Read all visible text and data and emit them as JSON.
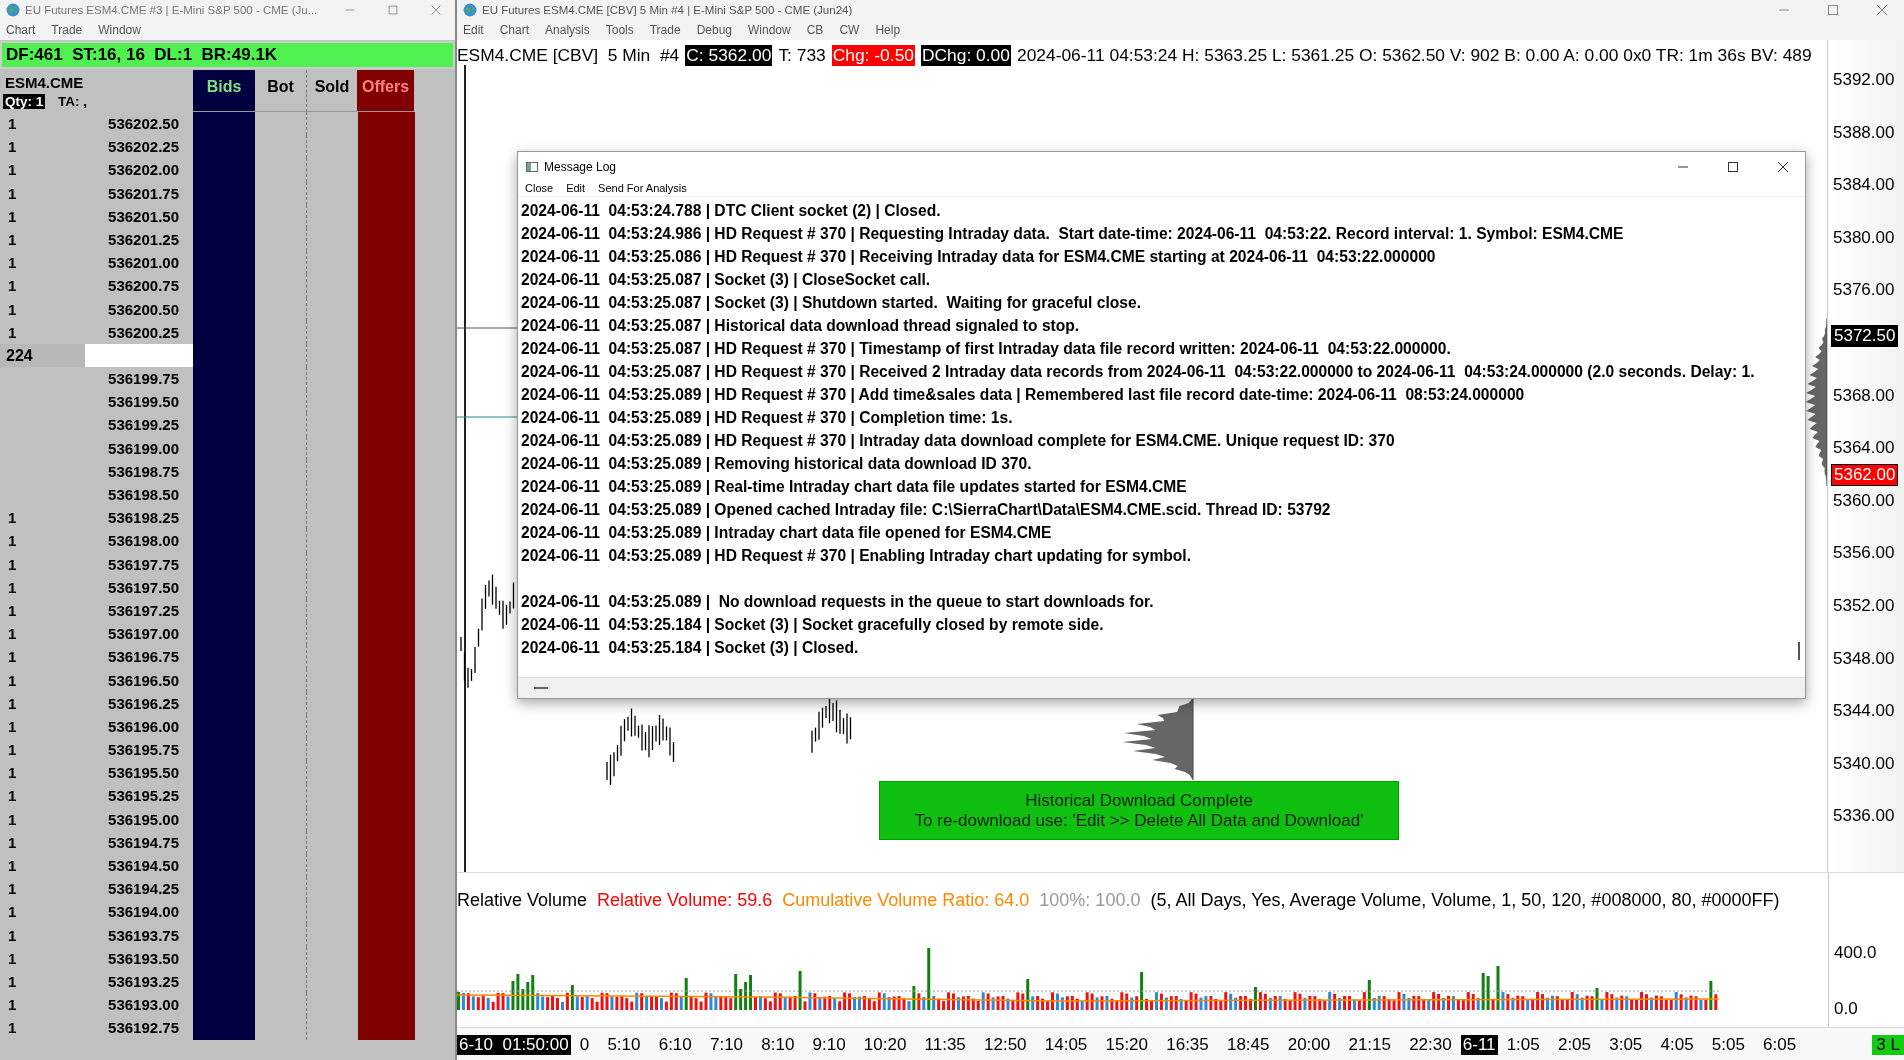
{
  "left_window": {
    "title": "EU Futures ESM4.CME #3 | E-Mini S&P 500 - CME (Ju...",
    "menu": [
      "Chart",
      "Trade",
      "Window"
    ],
    "status_text": "DF:461  ST:16, 16  DL:1  BR:49.1K",
    "symbol": "ESM4.CME",
    "qty_badge": "Qty: 1",
    "ta_label": "TA: ,",
    "columns": [
      {
        "label": "Bids",
        "kind": "bids"
      },
      {
        "label": "Bot",
        "kind": "plain"
      },
      {
        "label": "Sold",
        "kind": "plain"
      },
      {
        "label": "Offers",
        "kind": "offers"
      }
    ],
    "rows": [
      {
        "qty": "1",
        "price": "536202.50",
        "kind": "price"
      },
      {
        "qty": "1",
        "price": "536202.25",
        "kind": "price"
      },
      {
        "qty": "1",
        "price": "536202.00",
        "kind": "price"
      },
      {
        "qty": "1",
        "price": "536201.75",
        "kind": "price"
      },
      {
        "qty": "1",
        "price": "536201.50",
        "kind": "price"
      },
      {
        "qty": "1",
        "price": "536201.25",
        "kind": "price"
      },
      {
        "qty": "1",
        "price": "536201.00",
        "kind": "price"
      },
      {
        "qty": "1",
        "price": "536200.75",
        "kind": "price"
      },
      {
        "qty": "1",
        "price": "536200.50",
        "kind": "price"
      },
      {
        "qty": "1",
        "price": "536200.25",
        "kind": "price"
      },
      {
        "qty": "224",
        "kind": "current"
      },
      {
        "price": "536199.75",
        "kind": "price"
      },
      {
        "price": "536199.50",
        "kind": "price"
      },
      {
        "price": "536199.25",
        "kind": "price"
      },
      {
        "price": "536199.00",
        "kind": "price"
      },
      {
        "price": "536198.75",
        "kind": "price"
      },
      {
        "price": "536198.50",
        "kind": "price"
      },
      {
        "qty": "1",
        "price": "536198.25",
        "kind": "price"
      },
      {
        "qty": "1",
        "price": "536198.00",
        "kind": "price"
      },
      {
        "qty": "1",
        "price": "536197.75",
        "kind": "price"
      },
      {
        "qty": "1",
        "price": "536197.50",
        "kind": "price"
      },
      {
        "qty": "1",
        "price": "536197.25",
        "kind": "price"
      },
      {
        "qty": "1",
        "price": "536197.00",
        "kind": "price"
      },
      {
        "qty": "1",
        "price": "536196.75",
        "kind": "price"
      },
      {
        "qty": "1",
        "price": "536196.50",
        "kind": "price"
      },
      {
        "qty": "1",
        "price": "536196.25",
        "kind": "price"
      },
      {
        "qty": "1",
        "price": "536196.00",
        "kind": "price"
      },
      {
        "qty": "1",
        "price": "536195.75",
        "kind": "price"
      },
      {
        "qty": "1",
        "price": "536195.50",
        "kind": "price"
      },
      {
        "qty": "1",
        "price": "536195.25",
        "kind": "price"
      },
      {
        "qty": "1",
        "price": "536195.00",
        "kind": "price"
      },
      {
        "qty": "1",
        "price": "536194.75",
        "kind": "price"
      },
      {
        "qty": "1",
        "price": "536194.50",
        "kind": "price"
      },
      {
        "qty": "1",
        "price": "536194.25",
        "kind": "price"
      },
      {
        "qty": "1",
        "price": "536194.00",
        "kind": "price"
      },
      {
        "qty": "1",
        "price": "536193.75",
        "kind": "price"
      },
      {
        "qty": "1",
        "price": "536193.50",
        "kind": "price"
      },
      {
        "qty": "1",
        "price": "536193.25",
        "kind": "price"
      },
      {
        "qty": "1",
        "price": "536193.00",
        "kind": "price"
      },
      {
        "qty": "1",
        "price": "536192.75",
        "kind": "price"
      }
    ]
  },
  "chart_window": {
    "title": "EU Futures ESM4.CME [CBV]  5 Min  #4 | E-Mini S&P 500 - CME (Jun24)",
    "menu": [
      "Edit",
      "Chart",
      "Analysis",
      "Tools",
      "Trade",
      "Debug",
      "Window",
      "CB",
      "CW",
      "Help"
    ],
    "header": [
      {
        "text": "ESM4.CME [CBV]  5 Min  #4",
        "kind": "plain"
      },
      {
        "text": "C: 5362.00",
        "kind": "black"
      },
      {
        "text": "T: 733",
        "kind": "plain"
      },
      {
        "text": "Chg: -0.50",
        "kind": "red"
      },
      {
        "text": "DChg: 0.00",
        "kind": "black"
      },
      {
        "text": "2024-06-11 04:53:24 H: 5363.25 L: 5361.25 O: 5362.50 V: 902 B: 0.00 A: 0.00 0x0 TR: 1m 36s BV: 489",
        "kind": "plain"
      }
    ],
    "price_axis": [
      "5392.00",
      "5388.00",
      "5384.00",
      "5380.00",
      "5376.00",
      "5368.00",
      "5364.00",
      "5360.00",
      "5356.00",
      "5352.00",
      "5348.00",
      "5344.00",
      "5340.00",
      "5336.00"
    ],
    "price_markers": [
      {
        "text": "5372.50",
        "kind": "black"
      },
      {
        "text": "5362.00",
        "kind": "red"
      }
    ],
    "banner": [
      "Historical Download Complete",
      "To re-download use: 'Edit >> Delete All Data and Download'"
    ],
    "study_line": [
      {
        "text": "Relative Volume",
        "kind": "name"
      },
      {
        "text": "Relative Volume: 59.6",
        "kind": "red"
      },
      {
        "text": "Cumulative Volume Ratio: 64.0",
        "kind": "orange"
      },
      {
        "text": "100%: 100.0",
        "kind": "grey"
      },
      {
        "text": "(5, All Days, Yes, Average Volume, Volume, 1, 50, 120, #008000, 80, #0000FF)",
        "kind": "name"
      }
    ],
    "volume_axis": [
      "400.0",
      "0.0"
    ],
    "time_axis": [
      {
        "text": "6-10  01:50:00",
        "kind": "date"
      },
      {
        "text": "0",
        "kind": "time"
      },
      {
        "text": "5:10",
        "kind": "time"
      },
      {
        "text": "6:10",
        "kind": "time"
      },
      {
        "text": "7:10",
        "kind": "time"
      },
      {
        "text": "8:10",
        "kind": "time"
      },
      {
        "text": "9:10",
        "kind": "time"
      },
      {
        "text": "10:20",
        "kind": "time"
      },
      {
        "text": "11:35",
        "kind": "time"
      },
      {
        "text": "12:50",
        "kind": "time"
      },
      {
        "text": "14:05",
        "kind": "time"
      },
      {
        "text": "15:20",
        "kind": "time"
      },
      {
        "text": "16:35",
        "kind": "time"
      },
      {
        "text": "18:45",
        "kind": "time"
      },
      {
        "text": "20:00",
        "kind": "time"
      },
      {
        "text": "21:15",
        "kind": "time"
      },
      {
        "text": "22:30",
        "kind": "time"
      },
      {
        "text": "6-11",
        "kind": "date"
      },
      {
        "text": "1:05",
        "kind": "time"
      },
      {
        "text": "2:05",
        "kind": "time"
      },
      {
        "text": "3:05",
        "kind": "time"
      },
      {
        "text": "4:05",
        "kind": "time"
      },
      {
        "text": "5:05",
        "kind": "time"
      },
      {
        "text": "6:05",
        "kind": "time"
      }
    ],
    "corner_badge": "3 L"
  },
  "message_log": {
    "title": "Message Log",
    "menu": [
      "Close",
      "Edit",
      "Send For Analysis"
    ],
    "blocks": [
      {
        "lines": [
          "2024-06-11  04:53:24.788 | DTC Client socket (2) | Closed.",
          "2024-06-11  04:53:24.986 | HD Request # 370 | Requesting Intraday data.  Start date-time: 2024-06-11  04:53:22. Record interval: 1. Symbol: ESM4.CME",
          "2024-06-11  04:53:25.086 | HD Request # 370 | Receiving Intraday data for ESM4.CME starting at 2024-06-11  04:53:22.000000",
          "2024-06-11  04:53:25.087 | Socket (3) | CloseSocket call.",
          "2024-06-11  04:53:25.087 | Socket (3) | Shutdown started.  Waiting for graceful close.",
          "2024-06-11  04:53:25.087 | Historical data download thread signaled to stop.",
          "2024-06-11  04:53:25.087 | HD Request # 370 | Timestamp of first Intraday data file record written: 2024-06-11  04:53:22.000000.",
          "2024-06-11  04:53:25.087 | HD Request # 370 | Received 2 Intraday data records from 2024-06-11  04:53:22.000000 to 2024-06-11  04:53:24.000000 (2.0 seconds. Delay: 1.",
          "2024-06-11  04:53:25.089 | HD Request # 370 | Add time&sales data | Remembered last file record date-time: 2024-06-11  08:53:24.000000",
          "2024-06-11  04:53:25.089 | HD Request # 370 | Completion time: 1s.",
          "2024-06-11  04:53:25.089 | HD Request # 370 | Intraday data download complete for ESM4.CME. Unique request ID: 370",
          "2024-06-11  04:53:25.089 | Removing historical data download ID 370.",
          "2024-06-11  04:53:25.089 | Real-time Intraday chart data file updates started for ESM4.CME",
          "2024-06-11  04:53:25.089 | Opened cached Intraday file: C:\\SierraChart\\Data\\ESM4.CME.scid. Thread ID: 53792",
          "2024-06-11  04:53:25.089 | Intraday chart data file opened for ESM4.CME",
          "2024-06-11  04:53:25.089 | HD Request # 370 | Enabling Intraday chart updating for symbol."
        ]
      },
      {
        "lines": [
          "2024-06-11  04:53:25.089 |  No download requests in the queue to start downloads for.",
          "2024-06-11  04:53:25.184 | Socket (3) | Socket gracefully closed by remote side.",
          "2024-06-11  04:53:25.184 | Socket (3) | Closed."
        ]
      }
    ]
  }
}
